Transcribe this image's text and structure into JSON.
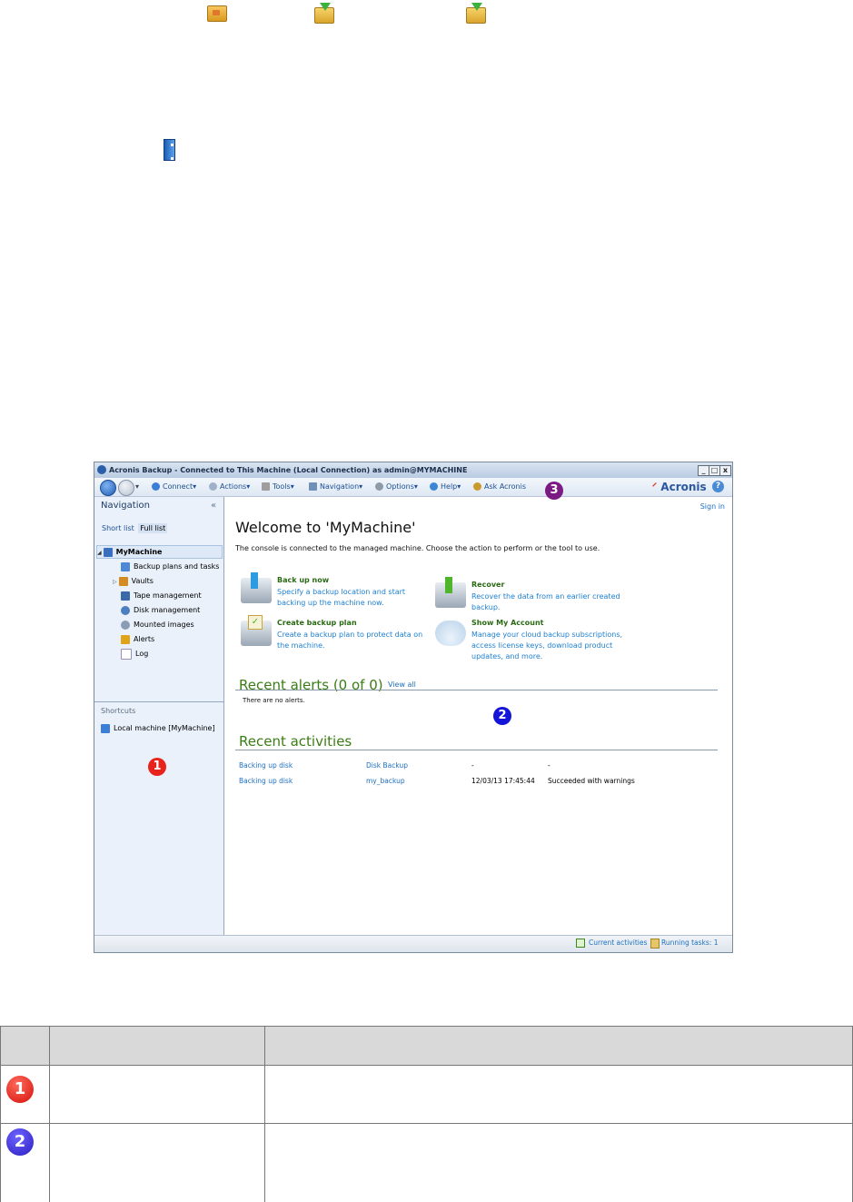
{
  "window": {
    "title": "Acronis Backup - Connected to This Machine (Local Connection) as admin@MYMACHINE",
    "minimize": "_",
    "maximize": "□",
    "close": "x"
  },
  "toolbar": {
    "connect": "Connect▾",
    "actions": "Actions▾",
    "tools": "Tools▾",
    "navigation": "Navigation▾",
    "options": "Options▾",
    "help": "Help▾",
    "ask": "Ask Acronis",
    "logo": "Acronis",
    "help_icon": "?"
  },
  "sidebar": {
    "title": "Navigation",
    "collapse": "«",
    "tabs": [
      "Short list",
      "Full list"
    ],
    "tree": [
      {
        "label": "MyMachine",
        "color": "#3a6fbf"
      },
      {
        "label": "Backup plans and tasks",
        "color": "#4d88d6"
      },
      {
        "label": "Vaults",
        "color": "#d58a22"
      },
      {
        "label": "Tape management",
        "color": "#3b6aa8"
      },
      {
        "label": "Disk management",
        "color": "#4b7fbf"
      },
      {
        "label": "Mounted images",
        "color": "#8a9db5"
      },
      {
        "label": "Alerts",
        "color": "#e0a31a"
      },
      {
        "label": "Log",
        "color": "#c2b7d8"
      }
    ],
    "expander_mymachine": "◢",
    "expander_vaults": "▷",
    "shortcuts_title": "Shortcuts",
    "shortcut_item": "Local machine [MyMachine]"
  },
  "main": {
    "sign_in": "Sign in",
    "welcome": "Welcome to 'MyMachine'",
    "subtitle": "The console is connected to the managed machine. Choose the action to perform or the tool to use.",
    "actions": [
      {
        "title": "Back up now",
        "desc": "Specify a backup location and start backing up the machine now."
      },
      {
        "title": "Recover",
        "desc": "Recover the data from an earlier created backup."
      },
      {
        "title": "Create backup plan",
        "desc": "Create a backup plan to protect data on the machine."
      },
      {
        "title": "Show My Account",
        "desc": "Manage your cloud backup subscriptions, access license keys, download product updates, and more."
      }
    ],
    "alerts_title": "Recent alerts (0 of 0)",
    "view_all": "View all",
    "no_alerts": "There are no alerts.",
    "activities_title": "Recent activities",
    "activities": [
      {
        "task": "Backing up disk",
        "plan": "Disk Backup",
        "time": "-",
        "result": "-"
      },
      {
        "task": "Backing up disk",
        "plan": "my_backup",
        "time": "12/03/13 17:45:44",
        "result": "Succeeded with warnings"
      }
    ]
  },
  "status": {
    "current": "Current activities",
    "running": "Running tasks: 1"
  },
  "badges": {
    "one": "1",
    "two": "2",
    "three": "3"
  },
  "table": {
    "header_col1": "",
    "header_col2": "",
    "header_col3": "",
    "row1_col2": "",
    "row1_col3": "",
    "row2_col2": "",
    "row2_col3": ""
  },
  "colors": {
    "badge_red": "#e8231d",
    "badge_blue": "#1414d8",
    "badge_purple": "#7a1a82",
    "badge_indigo": "#3125c4"
  }
}
